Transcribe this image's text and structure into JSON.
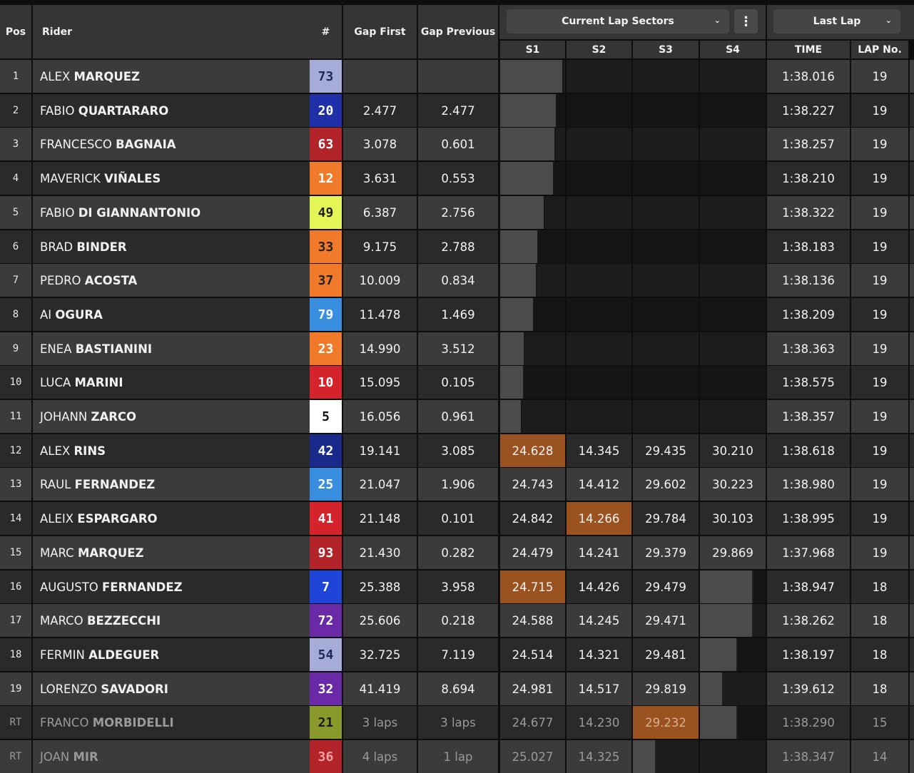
{
  "header": {
    "pos": "Pos",
    "rider": "Rider",
    "number": "#",
    "gap_first": "Gap First",
    "gap_previous": "Gap Previous",
    "sectors_dropdown": "Current Lap Sectors",
    "lap_dropdown": "Last Lap",
    "s1": "S1",
    "s2": "S2",
    "s3": "S3",
    "s4": "S4",
    "time": "TIME",
    "lap_no": "LAP No."
  },
  "colors": {
    "best_sector": "#9a5320",
    "row_light": "#3b3b3b",
    "row_dark": "#2a2a2a"
  },
  "rows": [
    {
      "pos": "1",
      "first": "ALEX",
      "last": "MARQUEZ",
      "num": "73",
      "num_bg": "#a6acd8",
      "num_fg": "#1b2a5a",
      "gap_first": "",
      "gap_prev": "",
      "s": [
        "",
        "",
        "",
        ""
      ],
      "progress": 0.89,
      "time": "1:38.016",
      "lap": "19"
    },
    {
      "pos": "2",
      "first": "FABIO",
      "last": "QUARTARARO",
      "num": "20",
      "num_bg": "#1f2fa8",
      "num_fg": "#ffffff",
      "gap_first": "2.477",
      "gap_prev": "2.477",
      "s": [
        "",
        "",
        "",
        ""
      ],
      "progress": 0.8,
      "time": "1:38.227",
      "lap": "19"
    },
    {
      "pos": "3",
      "first": "FRANCESCO",
      "last": "BAGNAIA",
      "num": "63",
      "num_bg": "#b2242a",
      "num_fg": "#ffffff",
      "gap_first": "3.078",
      "gap_prev": "0.601",
      "s": [
        "",
        "",
        "",
        ""
      ],
      "progress": 0.78,
      "time": "1:38.257",
      "lap": "19"
    },
    {
      "pos": "4",
      "first": "MAVERICK",
      "last": "VIÑALES",
      "num": "12",
      "num_bg": "#f07a2a",
      "num_fg": "#ffffff",
      "gap_first": "3.631",
      "gap_prev": "0.553",
      "s": [
        "",
        "",
        "",
        ""
      ],
      "progress": 0.76,
      "time": "1:38.210",
      "lap": "19"
    },
    {
      "pos": "5",
      "first": "FABIO",
      "last": "DI GIANNANTONIO",
      "num": "49",
      "num_bg": "#e4f556",
      "num_fg": "#202020",
      "gap_first": "6.387",
      "gap_prev": "2.756",
      "s": [
        "",
        "",
        "",
        ""
      ],
      "progress": 0.63,
      "time": "1:38.322",
      "lap": "19"
    },
    {
      "pos": "6",
      "first": "BRAD",
      "last": "BINDER",
      "num": "33",
      "num_bg": "#f07a2a",
      "num_fg": "#202020",
      "gap_first": "9.175",
      "gap_prev": "2.788",
      "s": [
        "",
        "",
        "",
        ""
      ],
      "progress": 0.54,
      "time": "1:38.183",
      "lap": "19"
    },
    {
      "pos": "7",
      "first": "PEDRO",
      "last": "ACOSTA",
      "num": "37",
      "num_bg": "#f07a2a",
      "num_fg": "#202020",
      "gap_first": "10.009",
      "gap_prev": "0.834",
      "s": [
        "",
        "",
        "",
        ""
      ],
      "progress": 0.52,
      "time": "1:38.136",
      "lap": "19"
    },
    {
      "pos": "8",
      "first": "AI",
      "last": "OGURA",
      "num": "79",
      "num_bg": "#3a8ee0",
      "num_fg": "#ffffff",
      "gap_first": "11.478",
      "gap_prev": "1.469",
      "s": [
        "",
        "",
        "",
        ""
      ],
      "progress": 0.48,
      "time": "1:38.209",
      "lap": "19"
    },
    {
      "pos": "9",
      "first": "ENEA",
      "last": "BASTIANINI",
      "num": "23",
      "num_bg": "#f07a2a",
      "num_fg": "#ffffff",
      "gap_first": "14.990",
      "gap_prev": "3.512",
      "s": [
        "",
        "",
        "",
        ""
      ],
      "progress": 0.35,
      "time": "1:38.363",
      "lap": "19"
    },
    {
      "pos": "10",
      "first": "LUCA",
      "last": "MARINI",
      "num": "10",
      "num_bg": "#d4232a",
      "num_fg": "#ffffff",
      "gap_first": "15.095",
      "gap_prev": "0.105",
      "s": [
        "",
        "",
        "",
        ""
      ],
      "progress": 0.34,
      "time": "1:38.575",
      "lap": "19"
    },
    {
      "pos": "11",
      "first": "JOHANN",
      "last": "ZARCO",
      "num": "5",
      "num_bg": "#ffffff",
      "num_fg": "#111111",
      "gap_first": "16.056",
      "gap_prev": "0.961",
      "s": [
        "",
        "",
        "",
        ""
      ],
      "progress": 0.31,
      "time": "1:38.357",
      "lap": "19"
    },
    {
      "pos": "12",
      "first": "ALEX",
      "last": "RINS",
      "num": "42",
      "num_bg": "#1a2a8a",
      "num_fg": "#ffffff",
      "gap_first": "19.141",
      "gap_prev": "3.085",
      "s": [
        "24.628",
        "14.345",
        "29.435",
        "30.210"
      ],
      "best": [
        true,
        false,
        false,
        false
      ],
      "time": "1:38.618",
      "lap": "19"
    },
    {
      "pos": "13",
      "first": "RAUL",
      "last": "FERNANDEZ",
      "num": "25",
      "num_bg": "#3a8ee0",
      "num_fg": "#ffffff",
      "gap_first": "21.047",
      "gap_prev": "1.906",
      "s": [
        "24.743",
        "14.412",
        "29.602",
        "30.223"
      ],
      "best": [
        false,
        false,
        false,
        false
      ],
      "time": "1:38.980",
      "lap": "19"
    },
    {
      "pos": "14",
      "first": "ALEIX",
      "last": "ESPARGARO",
      "num": "41",
      "num_bg": "#d4232a",
      "num_fg": "#ffffff",
      "gap_first": "21.148",
      "gap_prev": "0.101",
      "s": [
        "24.842",
        "14.266",
        "29.784",
        "30.103"
      ],
      "best": [
        false,
        true,
        false,
        false
      ],
      "time": "1:38.995",
      "lap": "19"
    },
    {
      "pos": "15",
      "first": "MARC",
      "last": "MARQUEZ",
      "num": "93",
      "num_bg": "#b2242a",
      "num_fg": "#ffffff",
      "gap_first": "21.430",
      "gap_prev": "0.282",
      "s": [
        "24.479",
        "14.241",
        "29.379",
        "29.869"
      ],
      "best": [
        false,
        false,
        false,
        false
      ],
      "time": "1:37.968",
      "lap": "19"
    },
    {
      "pos": "16",
      "first": "AUGUSTO",
      "last": "FERNANDEZ",
      "num": "7",
      "num_bg": "#1f44d8",
      "num_fg": "#ffffff",
      "gap_first": "25.388",
      "gap_prev": "3.958",
      "s": [
        "24.715",
        "14.426",
        "29.479",
        ""
      ],
      "best": [
        true,
        false,
        false,
        false
      ],
      "s4_progress": 0.85,
      "time": "1:38.947",
      "lap": "18"
    },
    {
      "pos": "17",
      "first": "MARCO",
      "last": "BEZZECCHI",
      "num": "72",
      "num_bg": "#6a2aa8",
      "num_fg": "#ffffff",
      "gap_first": "25.606",
      "gap_prev": "0.218",
      "s": [
        "24.588",
        "14.245",
        "29.471",
        ""
      ],
      "best": [
        false,
        false,
        false,
        false
      ],
      "s4_progress": 0.85,
      "time": "1:38.262",
      "lap": "18"
    },
    {
      "pos": "18",
      "first": "FERMIN",
      "last": "ALDEGUER",
      "num": "54",
      "num_bg": "#a6acd8",
      "num_fg": "#1b2a5a",
      "gap_first": "32.725",
      "gap_prev": "7.119",
      "s": [
        "24.514",
        "14.321",
        "29.481",
        ""
      ],
      "best": [
        false,
        false,
        false,
        false
      ],
      "s4_progress": 0.6,
      "time": "1:38.197",
      "lap": "18"
    },
    {
      "pos": "19",
      "first": "LORENZO",
      "last": "SAVADORI",
      "num": "32",
      "num_bg": "#6a2aa8",
      "num_fg": "#ffffff",
      "gap_first": "41.419",
      "gap_prev": "8.694",
      "s": [
        "24.981",
        "14.517",
        "29.819",
        ""
      ],
      "best": [
        false,
        false,
        false,
        false
      ],
      "s4_progress": 0.36,
      "time": "1:39.612",
      "lap": "18"
    },
    {
      "pos": "RT",
      "first": "FRANCO",
      "last": "MORBIDELLI",
      "num": "21",
      "num_bg": "#8a9a2a",
      "num_fg": "#1a1a1a",
      "gap_first": "3 laps",
      "gap_prev": "3 laps",
      "s": [
        "24.677",
        "14.230",
        "29.232",
        ""
      ],
      "best": [
        false,
        false,
        true,
        false
      ],
      "s4_progress": 0.6,
      "retired": true,
      "time": "1:38.290",
      "lap": "15"
    },
    {
      "pos": "RT",
      "first": "JOAN",
      "last": "MIR",
      "num": "36",
      "num_bg": "#b2242a",
      "num_fg": "#f0a0a0",
      "gap_first": "4 laps",
      "gap_prev": "1 lap",
      "s": [
        "25.027",
        "14.325",
        "",
        ""
      ],
      "best": [
        false,
        false,
        false,
        false
      ],
      "s3_progress": 0.36,
      "retired": true,
      "time": "1:38.347",
      "lap": "14"
    }
  ]
}
